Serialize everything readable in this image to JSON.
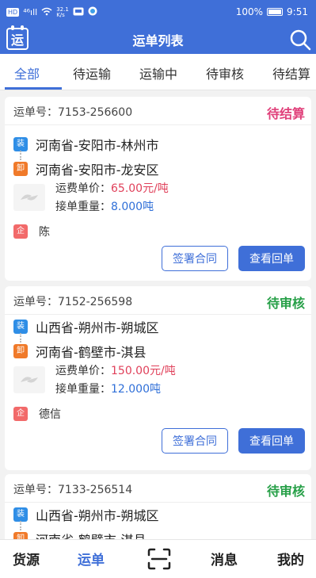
{
  "status_bar": {
    "left_badge": "HD",
    "signal": "⁴⁶ıll",
    "speed_value": "32.1",
    "speed_unit": "K/s",
    "battery": "100%",
    "time": "9:51"
  },
  "header": {
    "logo_char": "运",
    "title": "运单列表",
    "search_icon": "search-icon"
  },
  "tabs": [
    {
      "label": "全部",
      "active": true
    },
    {
      "label": "待运输",
      "active": false
    },
    {
      "label": "运输中",
      "active": false
    },
    {
      "label": "待审核",
      "active": false
    },
    {
      "label": "待结算",
      "active": false
    }
  ],
  "cards": [
    {
      "waybill_label": "运单号：7153-256600",
      "status": "待结算",
      "load_tag": "装",
      "origin": "河南省-安阳市-林州市",
      "unload_tag": "卸",
      "destination": "河南省-安阳市-龙安区",
      "price_label": "运费单价：",
      "price_value": "65.00元/吨",
      "weight_label": "接单重量：",
      "weight_value": "8.000吨",
      "company_tag": "企",
      "company": "陈",
      "sign_button": "签署合同",
      "receipt_button": "查看回单"
    },
    {
      "waybill_label": "运单号：7152-256598",
      "status": "待审核",
      "load_tag": "装",
      "origin": "山西省-朔州市-朔城区",
      "unload_tag": "卸",
      "destination": "河南省-鹤壁市-淇县",
      "price_label": "运费单价：",
      "price_value": "150.00元/吨",
      "weight_label": "接单重量：",
      "weight_value": "12.000吨",
      "company_tag": "企",
      "company": "德信",
      "sign_button": "签署合同",
      "receipt_button": "查看回单"
    },
    {
      "waybill_label": "运单号：7133-256514",
      "status": "待审核",
      "load_tag": "装",
      "origin": "山西省-朔州市-朔城区",
      "unload_tag": "卸",
      "destination": "河南省-鹤壁市-淇县"
    }
  ],
  "bottom_nav": {
    "items": [
      {
        "label": "货源",
        "active": false
      },
      {
        "label": "运单",
        "active": true
      },
      {
        "label": "消息",
        "active": false
      },
      {
        "label": "我的",
        "active": false
      }
    ],
    "scan_icon": "scan-icon"
  },
  "colors": {
    "primary": "#3f6fd8",
    "status_settle": "#e0407a",
    "status_review": "#27a048",
    "price": "#e0405a"
  }
}
